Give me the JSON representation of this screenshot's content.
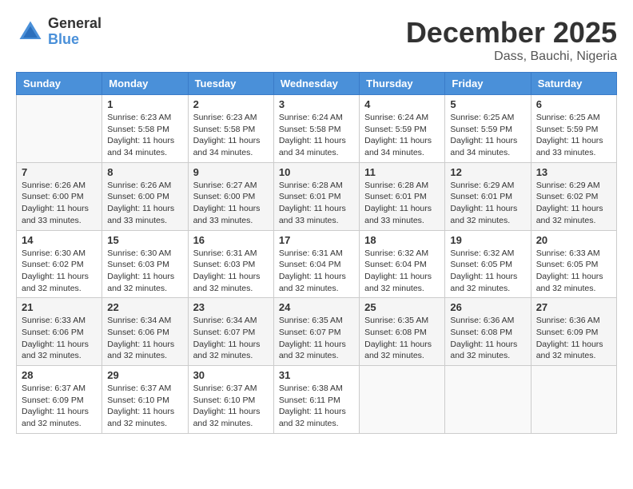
{
  "logo": {
    "general": "General",
    "blue": "Blue"
  },
  "title": "December 2025",
  "subtitle": "Dass, Bauchi, Nigeria",
  "days_of_week": [
    "Sunday",
    "Monday",
    "Tuesday",
    "Wednesday",
    "Thursday",
    "Friday",
    "Saturday"
  ],
  "weeks": [
    [
      {
        "day": "",
        "info": ""
      },
      {
        "day": "1",
        "info": "Sunrise: 6:23 AM\nSunset: 5:58 PM\nDaylight: 11 hours\nand 34 minutes."
      },
      {
        "day": "2",
        "info": "Sunrise: 6:23 AM\nSunset: 5:58 PM\nDaylight: 11 hours\nand 34 minutes."
      },
      {
        "day": "3",
        "info": "Sunrise: 6:24 AM\nSunset: 5:58 PM\nDaylight: 11 hours\nand 34 minutes."
      },
      {
        "day": "4",
        "info": "Sunrise: 6:24 AM\nSunset: 5:59 PM\nDaylight: 11 hours\nand 34 minutes."
      },
      {
        "day": "5",
        "info": "Sunrise: 6:25 AM\nSunset: 5:59 PM\nDaylight: 11 hours\nand 34 minutes."
      },
      {
        "day": "6",
        "info": "Sunrise: 6:25 AM\nSunset: 5:59 PM\nDaylight: 11 hours\nand 33 minutes."
      }
    ],
    [
      {
        "day": "7",
        "info": "Sunrise: 6:26 AM\nSunset: 6:00 PM\nDaylight: 11 hours\nand 33 minutes."
      },
      {
        "day": "8",
        "info": "Sunrise: 6:26 AM\nSunset: 6:00 PM\nDaylight: 11 hours\nand 33 minutes."
      },
      {
        "day": "9",
        "info": "Sunrise: 6:27 AM\nSunset: 6:00 PM\nDaylight: 11 hours\nand 33 minutes."
      },
      {
        "day": "10",
        "info": "Sunrise: 6:28 AM\nSunset: 6:01 PM\nDaylight: 11 hours\nand 33 minutes."
      },
      {
        "day": "11",
        "info": "Sunrise: 6:28 AM\nSunset: 6:01 PM\nDaylight: 11 hours\nand 33 minutes."
      },
      {
        "day": "12",
        "info": "Sunrise: 6:29 AM\nSunset: 6:01 PM\nDaylight: 11 hours\nand 32 minutes."
      },
      {
        "day": "13",
        "info": "Sunrise: 6:29 AM\nSunset: 6:02 PM\nDaylight: 11 hours\nand 32 minutes."
      }
    ],
    [
      {
        "day": "14",
        "info": "Sunrise: 6:30 AM\nSunset: 6:02 PM\nDaylight: 11 hours\nand 32 minutes."
      },
      {
        "day": "15",
        "info": "Sunrise: 6:30 AM\nSunset: 6:03 PM\nDaylight: 11 hours\nand 32 minutes."
      },
      {
        "day": "16",
        "info": "Sunrise: 6:31 AM\nSunset: 6:03 PM\nDaylight: 11 hours\nand 32 minutes."
      },
      {
        "day": "17",
        "info": "Sunrise: 6:31 AM\nSunset: 6:04 PM\nDaylight: 11 hours\nand 32 minutes."
      },
      {
        "day": "18",
        "info": "Sunrise: 6:32 AM\nSunset: 6:04 PM\nDaylight: 11 hours\nand 32 minutes."
      },
      {
        "day": "19",
        "info": "Sunrise: 6:32 AM\nSunset: 6:05 PM\nDaylight: 11 hours\nand 32 minutes."
      },
      {
        "day": "20",
        "info": "Sunrise: 6:33 AM\nSunset: 6:05 PM\nDaylight: 11 hours\nand 32 minutes."
      }
    ],
    [
      {
        "day": "21",
        "info": "Sunrise: 6:33 AM\nSunset: 6:06 PM\nDaylight: 11 hours\nand 32 minutes."
      },
      {
        "day": "22",
        "info": "Sunrise: 6:34 AM\nSunset: 6:06 PM\nDaylight: 11 hours\nand 32 minutes."
      },
      {
        "day": "23",
        "info": "Sunrise: 6:34 AM\nSunset: 6:07 PM\nDaylight: 11 hours\nand 32 minutes."
      },
      {
        "day": "24",
        "info": "Sunrise: 6:35 AM\nSunset: 6:07 PM\nDaylight: 11 hours\nand 32 minutes."
      },
      {
        "day": "25",
        "info": "Sunrise: 6:35 AM\nSunset: 6:08 PM\nDaylight: 11 hours\nand 32 minutes."
      },
      {
        "day": "26",
        "info": "Sunrise: 6:36 AM\nSunset: 6:08 PM\nDaylight: 11 hours\nand 32 minutes."
      },
      {
        "day": "27",
        "info": "Sunrise: 6:36 AM\nSunset: 6:09 PM\nDaylight: 11 hours\nand 32 minutes."
      }
    ],
    [
      {
        "day": "28",
        "info": "Sunrise: 6:37 AM\nSunset: 6:09 PM\nDaylight: 11 hours\nand 32 minutes."
      },
      {
        "day": "29",
        "info": "Sunrise: 6:37 AM\nSunset: 6:10 PM\nDaylight: 11 hours\nand 32 minutes."
      },
      {
        "day": "30",
        "info": "Sunrise: 6:37 AM\nSunset: 6:10 PM\nDaylight: 11 hours\nand 32 minutes."
      },
      {
        "day": "31",
        "info": "Sunrise: 6:38 AM\nSunset: 6:11 PM\nDaylight: 11 hours\nand 32 minutes."
      },
      {
        "day": "",
        "info": ""
      },
      {
        "day": "",
        "info": ""
      },
      {
        "day": "",
        "info": ""
      }
    ]
  ]
}
